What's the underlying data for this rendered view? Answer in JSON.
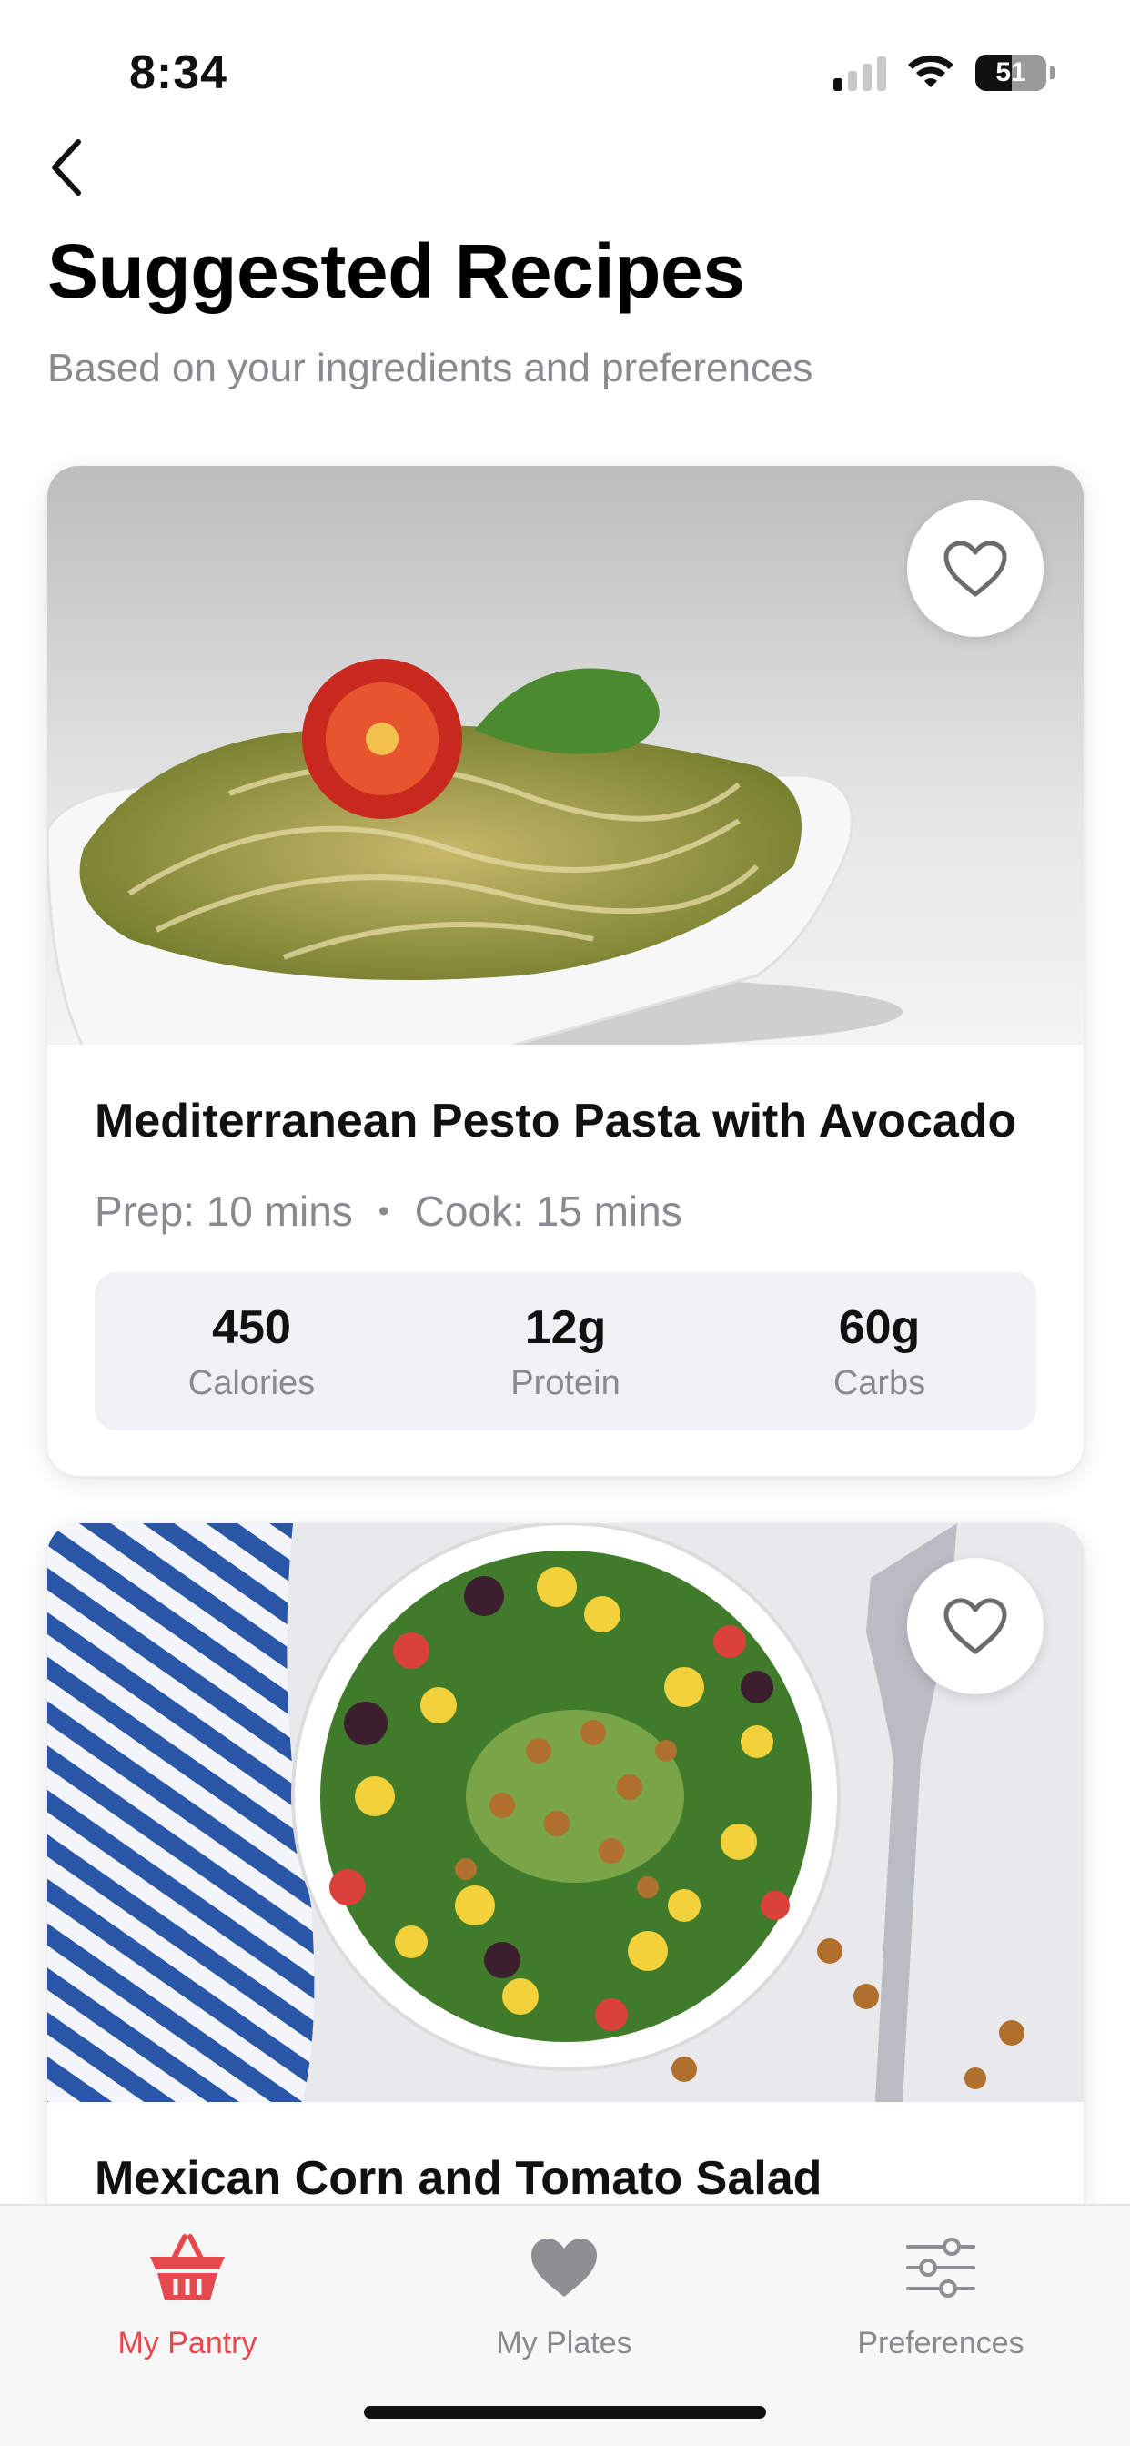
{
  "status_bar": {
    "time": "8:34",
    "battery": "51"
  },
  "header": {
    "title": "Suggested Recipes",
    "subtitle": "Based on your ingredients and preferences"
  },
  "recipes": [
    {
      "title": "Mediterranean Pesto Pasta with Avocado",
      "prep": "Prep: 10 mins",
      "separator": "•",
      "cook": "Cook: 15 mins",
      "nutrition": [
        {
          "value": "450",
          "label": "Calories"
        },
        {
          "value": "12g",
          "label": "Protein"
        },
        {
          "value": "60g",
          "label": "Carbs"
        }
      ]
    },
    {
      "title": "Mexican Corn and Tomato Salad"
    }
  ],
  "tabs": [
    {
      "label": "My Pantry",
      "icon": "basket-icon",
      "active": true
    },
    {
      "label": "My Plates",
      "icon": "heart-icon",
      "active": false
    },
    {
      "label": "Preferences",
      "icon": "sliders-icon",
      "active": false
    }
  ],
  "colors": {
    "accent": "#e5484d",
    "muted": "#8a8a8e",
    "tile_bg": "#f1f1f5"
  }
}
